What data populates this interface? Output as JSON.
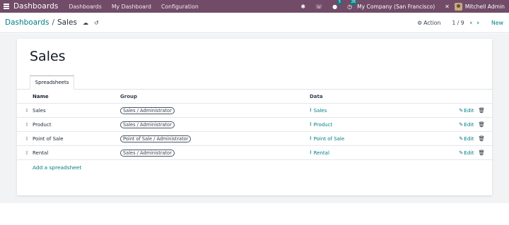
{
  "navbar": {
    "brand": "Dashboards",
    "menu": [
      "Dashboards",
      "My Dashboard",
      "Configuration"
    ],
    "messages_count": "5",
    "activities_count": "26",
    "company": "My Company (San Francisco)",
    "user": "Mitchell Admin"
  },
  "control_panel": {
    "parent": "Dashboards",
    "current": "Sales",
    "action_label": "Action",
    "pager": "1 / 9",
    "new_label": "New"
  },
  "form": {
    "title": "Sales",
    "tab_label": "Spreadsheets",
    "columns": {
      "name": "Name",
      "group": "Group",
      "data": "Data"
    },
    "rows": [
      {
        "name": "Sales",
        "group": "Sales / Administrator",
        "data": "Sales"
      },
      {
        "name": "Product",
        "group": "Sales / Administrator",
        "data": "Product"
      },
      {
        "name": "Point of Sale",
        "group": "Point of Sale / Administrator",
        "data": "Point of Sale"
      },
      {
        "name": "Rental",
        "group": "Sales / Administrator",
        "data": "Rental"
      }
    ],
    "edit_label": "Edit",
    "add_label": "Add a spreadsheet"
  },
  "colors": {
    "navbar": "#714b67",
    "accent": "#017e84"
  },
  "icons": {
    "apps": "apps-grid-icon",
    "bug": "bug-icon",
    "support": "support-icon",
    "messages": "chat-icon",
    "activities": "clock-icon",
    "settings": "tools-icon",
    "save": "cloud-upload-icon",
    "discard": "undo-icon",
    "action": "gear-icon",
    "handle": "drag-handle-icon",
    "download": "download-icon",
    "edit": "pencil-icon",
    "delete": "trash-icon"
  }
}
